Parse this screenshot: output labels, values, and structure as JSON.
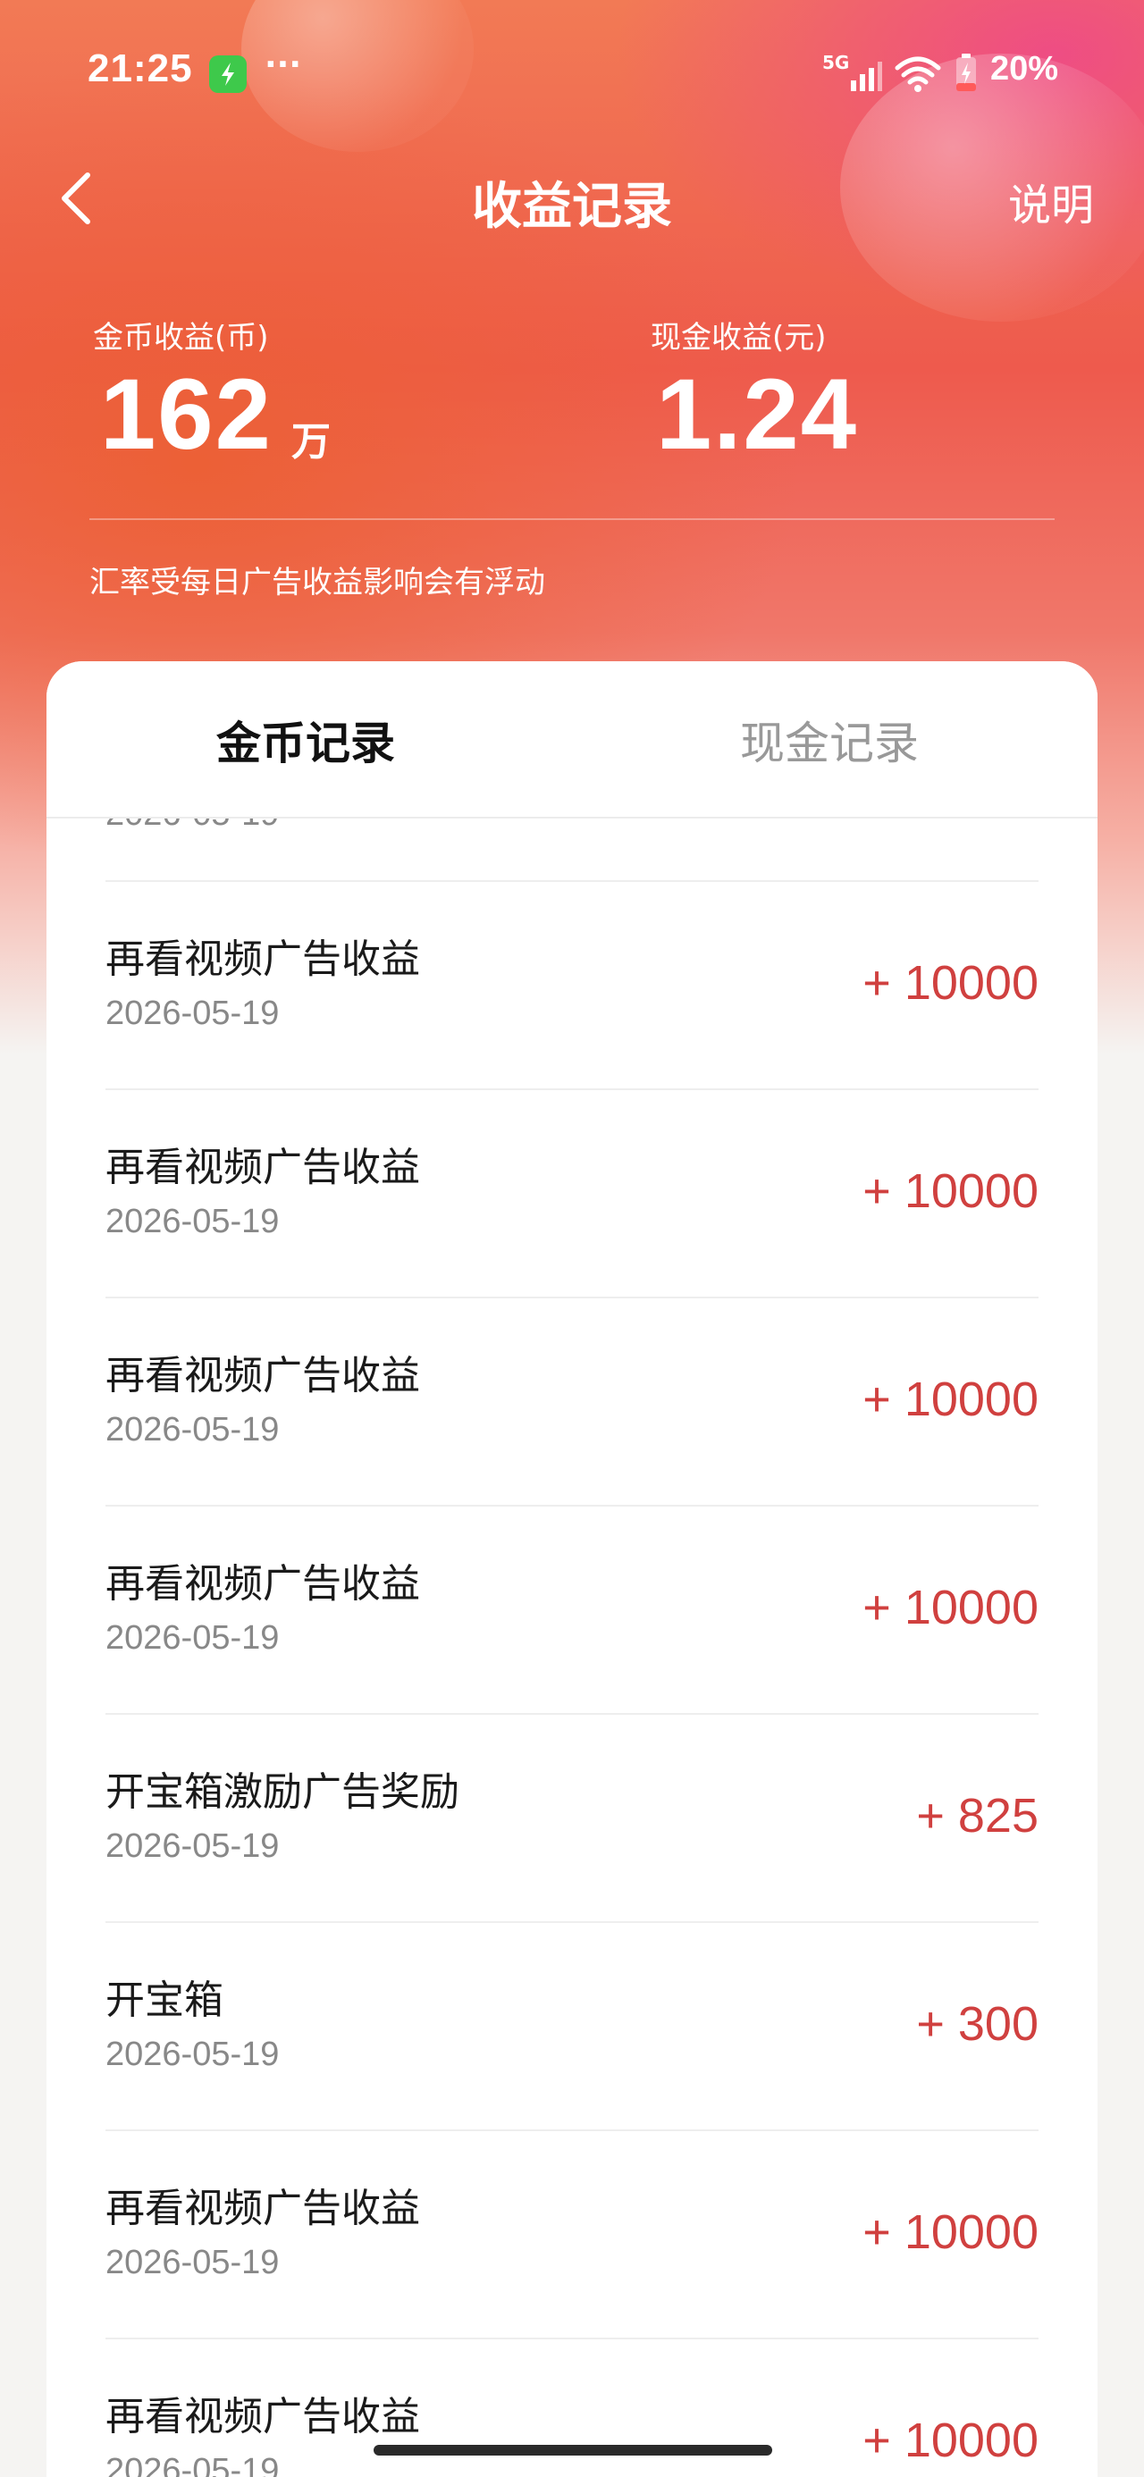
{
  "status_bar": {
    "time": "21:25",
    "dots": "···",
    "network": "5G",
    "battery": "20%"
  },
  "nav": {
    "title": "收益记录",
    "help": "说明"
  },
  "summary": {
    "coin_label": "金币收益(币)",
    "coin_value": "162",
    "coin_unit": "万",
    "cash_label": "现金收益(元)",
    "cash_value": "1.24",
    "note": "汇率受每日广告收益影响会有浮动"
  },
  "tabs": {
    "active": "金币记录",
    "inactive": "现金记录"
  },
  "records": [
    {
      "title": "再看视频广告收益",
      "date": "2026-05-19",
      "amount": "+ 10000"
    },
    {
      "title": "再看视频广告收益",
      "date": "2026-05-19",
      "amount": "+ 10000"
    },
    {
      "title": "再看视频广告收益",
      "date": "2026-05-19",
      "amount": "+ 10000"
    },
    {
      "title": "再看视频广告收益",
      "date": "2026-05-19",
      "amount": "+ 10000"
    },
    {
      "title": "开宝箱激励广告奖励",
      "date": "2026-05-19",
      "amount": "+ 825"
    },
    {
      "title": "开宝箱",
      "date": "2026-05-19",
      "amount": "+ 300"
    },
    {
      "title": "再看视频广告收益",
      "date": "2026-05-19",
      "amount": "+ 10000"
    },
    {
      "title": "再看视频广告收益",
      "date": "2026-05-19",
      "amount": "+ 10000"
    }
  ],
  "partial_top_record": {
    "date": "2026-05-19"
  },
  "colors": {
    "amount": "#d0403f",
    "header_primary": "#ee5a4d",
    "header_accent": "#ee468c"
  }
}
